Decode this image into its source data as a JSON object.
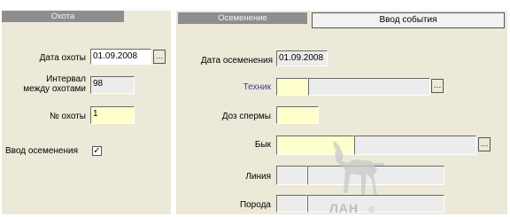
{
  "left": {
    "header": "Охота",
    "hunt_date_label": "Дата охоты",
    "hunt_date_value": "01.09.2008",
    "interval_label_1": "Интервал",
    "interval_label_2": "между охотами",
    "interval_value": "98",
    "hunt_no_label": "№ охоты",
    "hunt_no_value": "1",
    "insem_entry_label": "Ввод осеменения",
    "insem_entry_checked": "✓"
  },
  "right": {
    "header": "Осеменение",
    "event_button": "Ввод события",
    "insem_date_label": "Дата осеменения",
    "insem_date_value": "01.09.2008",
    "tech_label": "Техник",
    "doses_label": "Доз спермы",
    "bull_label": "Бык",
    "line_label": "Линия",
    "breed_label": "Порода"
  },
  "watermark_text": "ЛАН",
  "colors": {
    "panel": "#ece9d8",
    "header": "#8e8e8e",
    "required_field": "#ffffcc",
    "tech_label": "#3b3b9e"
  },
  "icons": [
    "ellipsis-button",
    "checkbox-check",
    "deer-watermark"
  ]
}
